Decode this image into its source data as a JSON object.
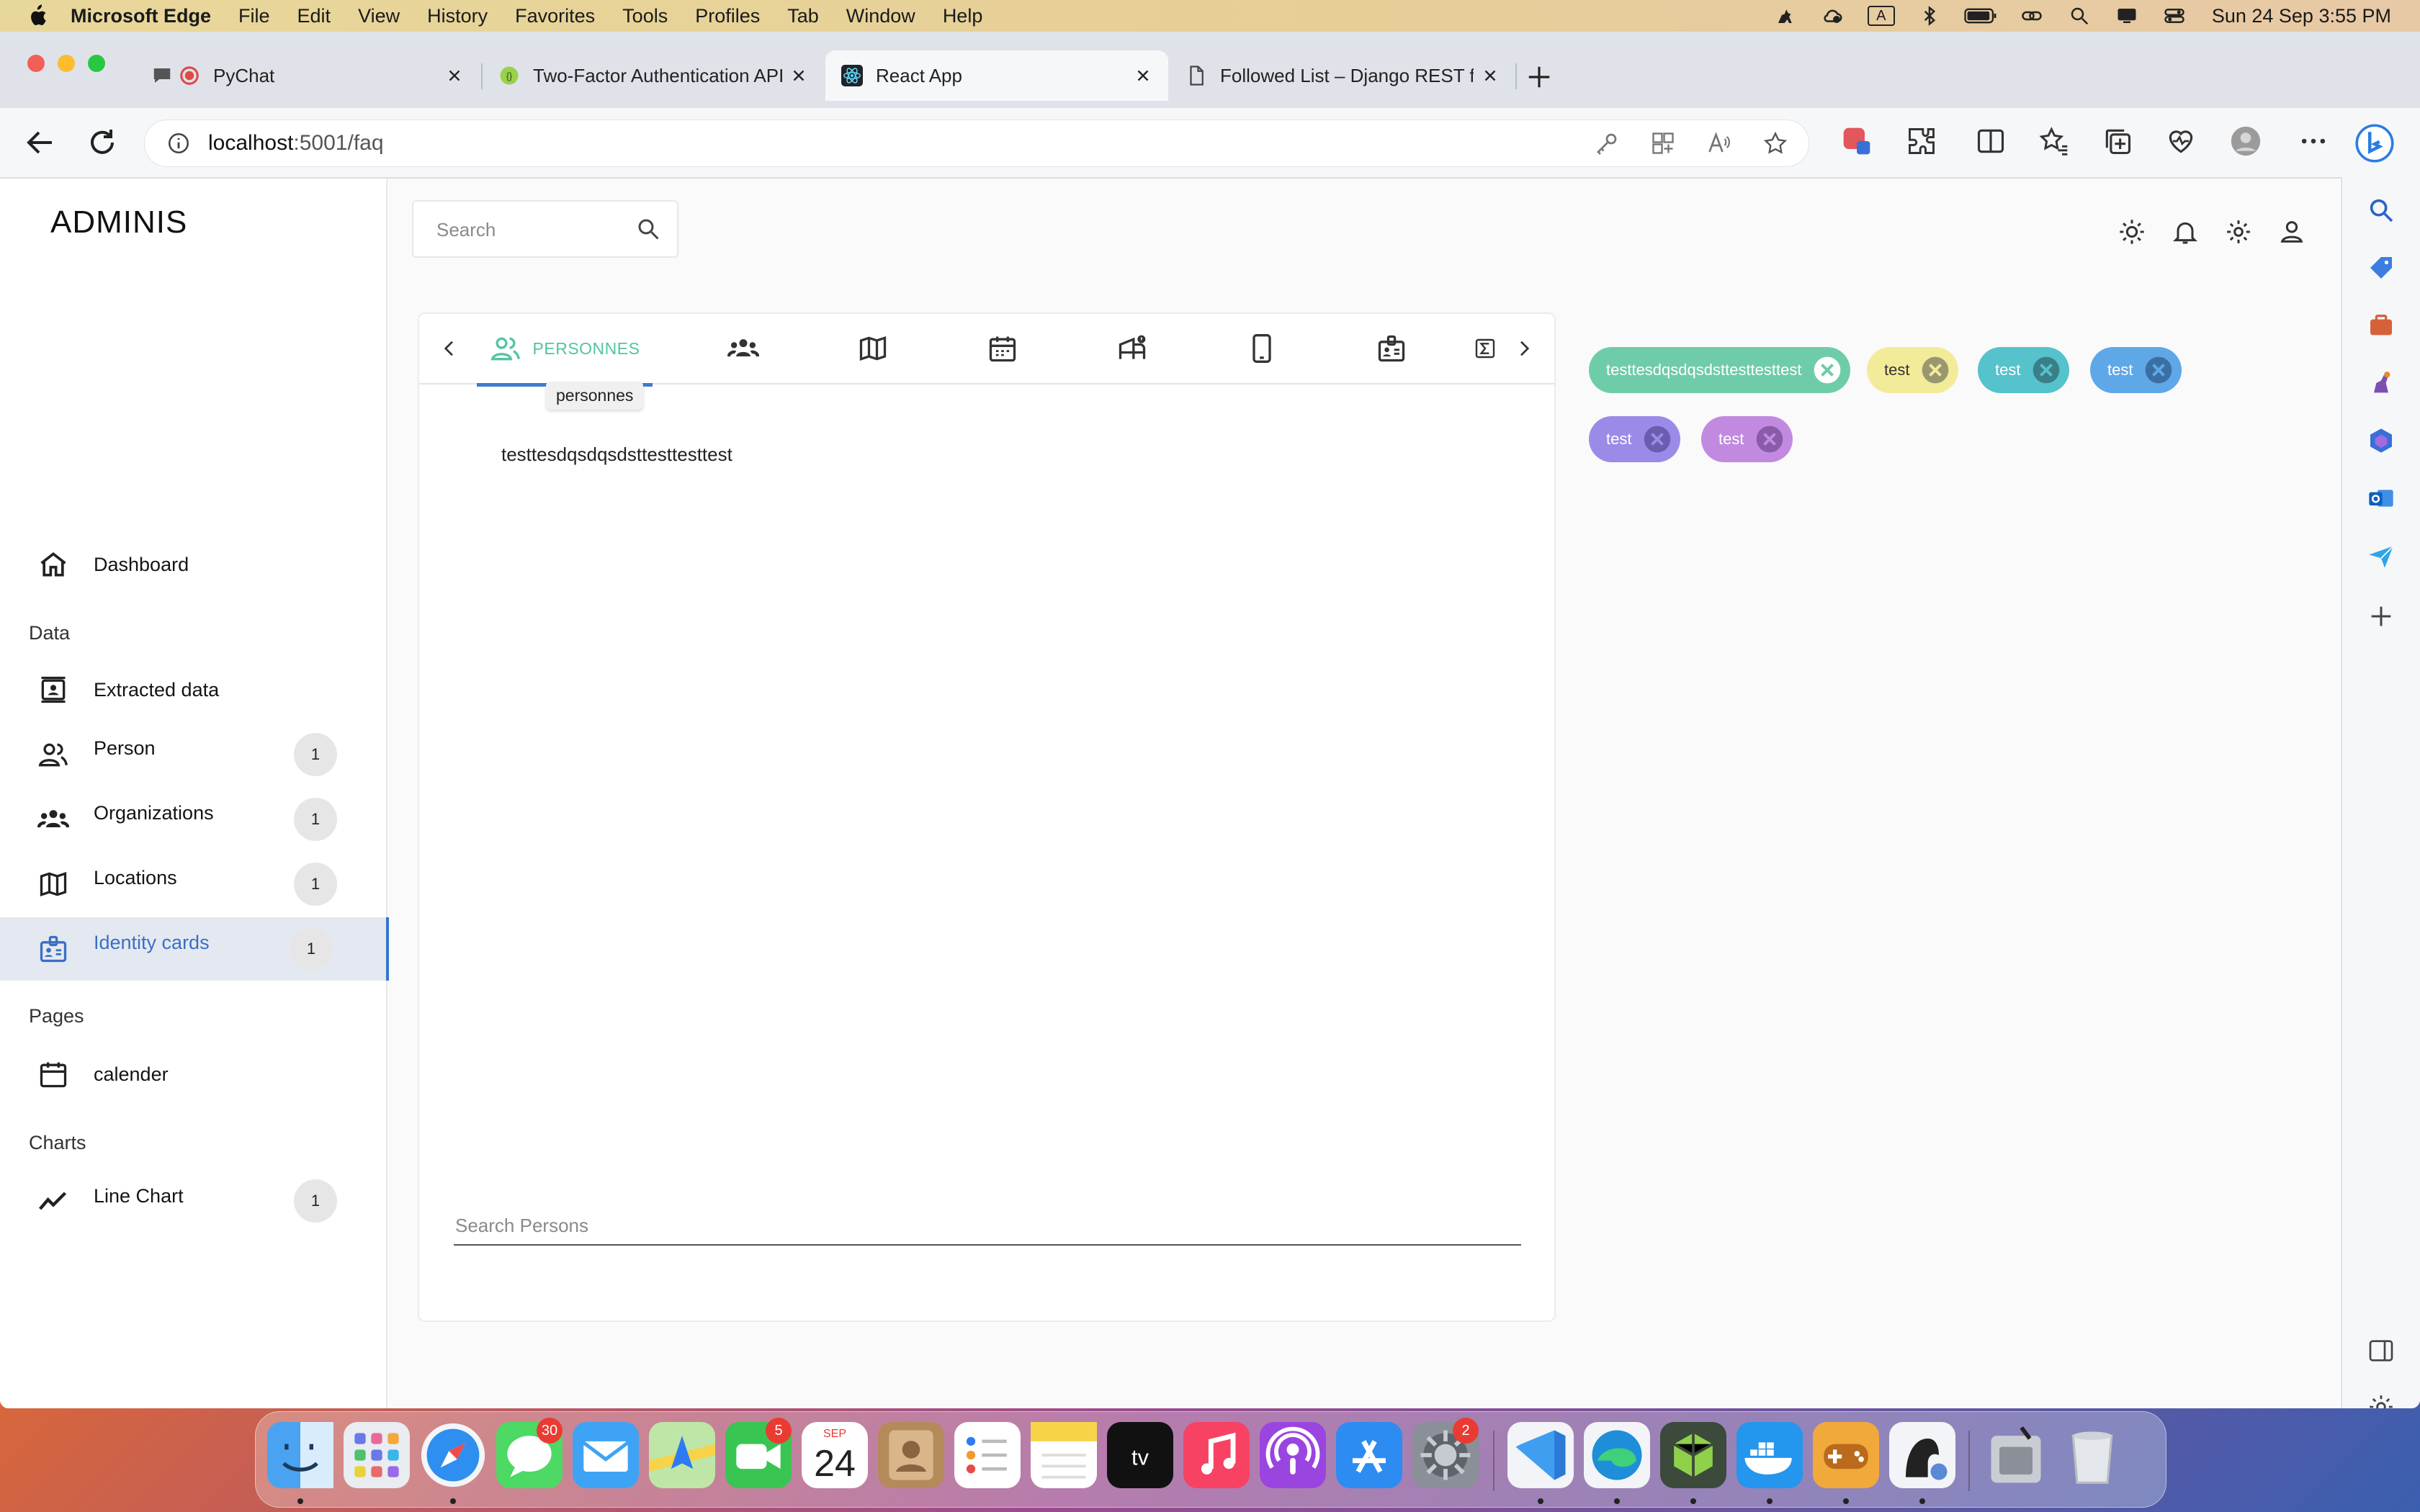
{
  "menubar": {
    "app_name": "Microsoft Edge",
    "items": [
      "File",
      "Edit",
      "View",
      "History",
      "Favorites",
      "Tools",
      "Profiles",
      "Tab",
      "Window",
      "Help"
    ],
    "input_indicator": "A",
    "clock": "Sun 24 Sep  3:55 PM"
  },
  "browser": {
    "tabs": [
      {
        "title": "PyChat",
        "icon": "chat-icon"
      },
      {
        "title": "Two-Factor Authentication API",
        "icon": "api-icon"
      },
      {
        "title": "React App",
        "icon": "react-icon"
      },
      {
        "title": "Followed List – Django REST fr",
        "icon": "page-icon"
      }
    ],
    "active_tab": 2,
    "url_host": "localhost",
    "url_path": ":5001/faq"
  },
  "app": {
    "logo": "ADMINIS",
    "search_placeholder": "Search",
    "nav": {
      "dashboard": "Dashboard",
      "section_data": "Data",
      "items": [
        {
          "label": "Extracted data",
          "icon": "contact-card-icon",
          "badge": ""
        },
        {
          "label": "Person",
          "icon": "people-icon",
          "badge": "1"
        },
        {
          "label": "Organizations",
          "icon": "groups-icon",
          "badge": "1"
        },
        {
          "label": "Locations",
          "icon": "map-icon",
          "badge": "1"
        },
        {
          "label": "Identity cards",
          "icon": "badge-icon",
          "badge": "1"
        }
      ],
      "section_pages": "Pages",
      "calender": "calender",
      "section_charts": "Charts",
      "line_chart": "Line Chart",
      "line_chart_badge": "1"
    },
    "tabs": {
      "active_label": "PERSONNES",
      "tooltip": "personnes",
      "icons": [
        "people-icon",
        "groups-icon",
        "map-icon",
        "calendar-icon",
        "hotel-icon",
        "phone-icon",
        "badge-icon",
        "sigma-icon"
      ]
    },
    "result_text": "testtesdqsdqsdsttesttesttest",
    "person_search_placeholder": "Search Persons",
    "chips": [
      {
        "label": "testtesdqsdqsdsttesttesttest",
        "color": "#6fcca8"
      },
      {
        "label": "test",
        "color": "#f2ec9a"
      },
      {
        "label": "test",
        "color": "#55c2cc"
      },
      {
        "label": "test",
        "color": "#5ea8e8"
      },
      {
        "label": "test",
        "color": "#9c8ae8"
      },
      {
        "label": "test",
        "color": "#c18ae0"
      }
    ],
    "accent_color": "#3874cb"
  },
  "dock": {
    "apps": [
      "Finder",
      "Launchpad",
      "Safari",
      "Messages",
      "Mail",
      "Maps",
      "FaceTime",
      "Calendar",
      "Contacts",
      "Reminders",
      "Notes",
      "TV",
      "Music",
      "Podcasts",
      "App Store",
      "System Preferences",
      "Visual Studio Code",
      "Microsoft Edge",
      "Sublime",
      "Docker",
      "Game",
      "Sequel",
      "Downloads",
      "Trash"
    ],
    "badges": {
      "Messages": "30",
      "FaceTime": "5",
      "System Preferences": "2"
    },
    "calendar_month": "SEP",
    "calendar_day": "24"
  }
}
